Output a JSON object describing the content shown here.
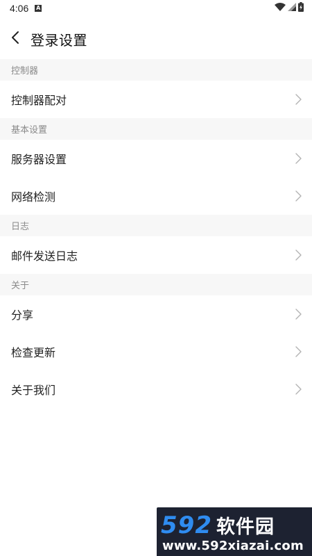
{
  "status_bar": {
    "time": "4:06",
    "notification_badge": "A",
    "icons": [
      "wifi-icon",
      "signal-icon",
      "battery-icon"
    ]
  },
  "header": {
    "title": "登录设置",
    "back_icon": "chevron-left-icon"
  },
  "sections": [
    {
      "title": "控制器",
      "items": [
        {
          "label": "控制器配对"
        }
      ]
    },
    {
      "title": "基本设置",
      "items": [
        {
          "label": "服务器设置"
        },
        {
          "label": "网络检测"
        }
      ]
    },
    {
      "title": "日志",
      "items": [
        {
          "label": "邮件发送日志"
        }
      ]
    },
    {
      "title": "关于",
      "items": [
        {
          "label": "分享"
        },
        {
          "label": "检查更新"
        },
        {
          "label": "关于我们"
        }
      ]
    }
  ],
  "watermark": {
    "number": "592",
    "brand": "软件园",
    "url": "www.592xiazai.com"
  },
  "colors": {
    "section_bg": "#f7f7f7",
    "section_text": "#8a8a8a",
    "chevron": "#b3b3b3",
    "watermark_bg": "#1d2231",
    "watermark_accent": "#2f8cf0"
  }
}
